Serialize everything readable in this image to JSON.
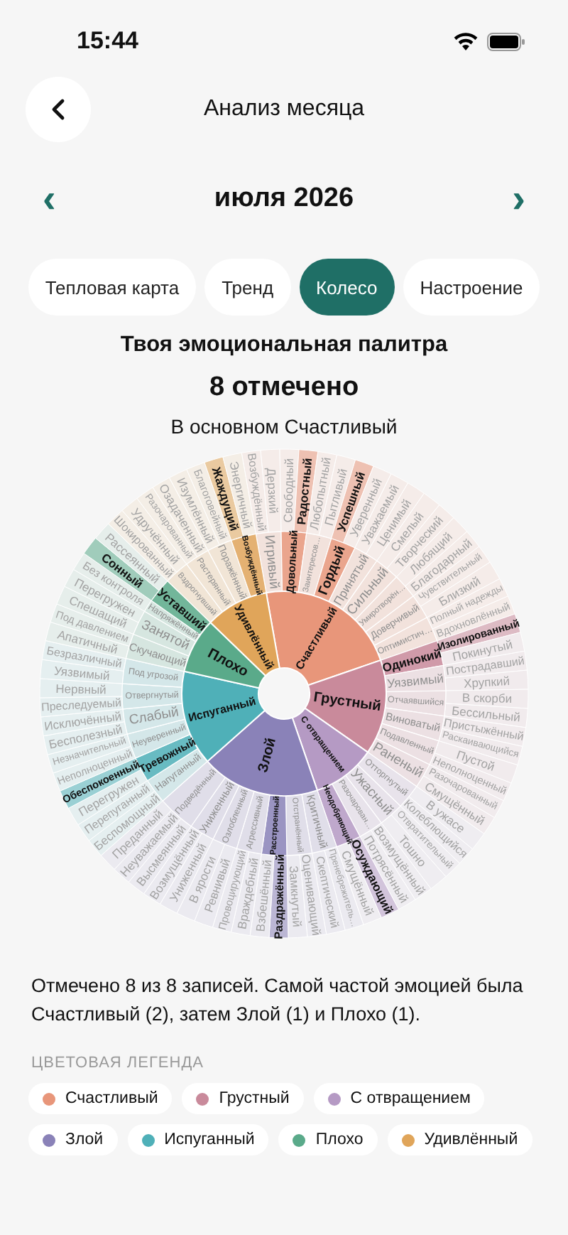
{
  "status_bar": {
    "time": "15:44"
  },
  "header": {
    "title": "Анализ месяца"
  },
  "month_nav": {
    "prev": "‹",
    "label": "июля 2026",
    "next": "›"
  },
  "tabs": [
    {
      "label": "Тепловая карта",
      "selected": false
    },
    {
      "label": "Тренд",
      "selected": false
    },
    {
      "label": "Колесо",
      "selected": true
    },
    {
      "label": "Настроение",
      "selected": false
    }
  ],
  "summary": {
    "title": "Твоя эмоциональная палитра",
    "count": "8 отмечено",
    "subtitle": "В основном Счастливый"
  },
  "wheel": {
    "core": [
      {
        "label": "Счастливый",
        "color": "#e8967a",
        "marked": true,
        "children": [
          {
            "label": "Игривый",
            "marked": false,
            "children": [
              {
                "label": "Возбуждённый",
                "marked": false
              },
              {
                "label": "Дерзкий",
                "marked": false
              }
            ]
          },
          {
            "label": "Довольный",
            "marked": true,
            "children": [
              {
                "label": "Свободный",
                "marked": false
              },
              {
                "label": "Радостный",
                "marked": true
              }
            ]
          },
          {
            "label": "Заинтересов…",
            "marked": false,
            "children": [
              {
                "label": "Любопытный",
                "marked": false
              },
              {
                "label": "Пытливый",
                "marked": false
              }
            ]
          },
          {
            "label": "Гордый",
            "marked": true,
            "children": [
              {
                "label": "Успешный",
                "marked": true
              },
              {
                "label": "Уверенный",
                "marked": false
              }
            ]
          },
          {
            "label": "Принятый",
            "marked": false,
            "children": [
              {
                "label": "Уважаемый",
                "marked": false
              },
              {
                "label": "Ценимый",
                "marked": false
              }
            ]
          },
          {
            "label": "Сильный",
            "marked": false,
            "children": [
              {
                "label": "Смелый",
                "marked": false
              },
              {
                "label": "Творческий",
                "marked": false
              }
            ]
          },
          {
            "label": "Умиротворён…",
            "marked": false,
            "children": [
              {
                "label": "Любящий",
                "marked": false
              },
              {
                "label": "Благодарный",
                "marked": false
              }
            ]
          },
          {
            "label": "Доверчивый",
            "marked": false,
            "children": [
              {
                "label": "Чувствительный",
                "marked": false
              },
              {
                "label": "Близкий",
                "marked": false
              }
            ]
          },
          {
            "label": "Оптимистич…",
            "marked": false,
            "children": [
              {
                "label": "Полный надежды",
                "marked": false
              },
              {
                "label": "Вдохновлённый",
                "marked": false
              }
            ]
          }
        ]
      },
      {
        "label": "Грустный",
        "color": "#c98a9b",
        "marked": true,
        "children": [
          {
            "label": "Одинокий",
            "marked": true,
            "children": [
              {
                "label": "Изолированный",
                "marked": true
              },
              {
                "label": "Покинутый",
                "marked": false
              }
            ]
          },
          {
            "label": "Уязвимый",
            "marked": false,
            "children": [
              {
                "label": "Пострадавший",
                "marked": false
              },
              {
                "label": "Хрупкий",
                "marked": false
              }
            ]
          },
          {
            "label": "Отчаявшийся",
            "marked": false,
            "children": [
              {
                "label": "В скорби",
                "marked": false
              },
              {
                "label": "Бессильный",
                "marked": false
              }
            ]
          },
          {
            "label": "Виноватый",
            "marked": false,
            "children": [
              {
                "label": "Пристыжённый",
                "marked": false
              },
              {
                "label": "Раскаивающийся",
                "marked": false
              }
            ]
          },
          {
            "label": "Подавленный",
            "marked": false,
            "children": [
              {
                "label": "Пустой",
                "marked": false
              },
              {
                "label": "Неполноценный",
                "marked": false
              }
            ]
          },
          {
            "label": "Раненый",
            "marked": false,
            "children": [
              {
                "label": "Разочарованный",
                "marked": false
              },
              {
                "label": "Смущённый",
                "marked": false
              }
            ]
          }
        ]
      },
      {
        "label": "С отвращением",
        "color": "#b59ac4",
        "marked": true,
        "children": [
          {
            "label": "Отторгнутый",
            "marked": false,
            "children": [
              {
                "label": "В ужасе",
                "marked": false
              },
              {
                "label": "Колеблющийся",
                "marked": false
              }
            ]
          },
          {
            "label": "Ужасный",
            "marked": false,
            "children": [
              {
                "label": "Отвратительный",
                "marked": false
              },
              {
                "label": "Тошно",
                "marked": false
              }
            ]
          },
          {
            "label": "Разочарован…",
            "marked": false,
            "children": [
              {
                "label": "Возмущённый",
                "marked": false
              },
              {
                "label": "Потрясённый",
                "marked": false
              }
            ]
          },
          {
            "label": "Неодобряющий",
            "marked": true,
            "children": [
              {
                "label": "Осуждающий",
                "marked": true
              },
              {
                "label": "Смущённый",
                "marked": false
              }
            ]
          }
        ]
      },
      {
        "label": "Злой",
        "color": "#8a82b8",
        "marked": true,
        "children": [
          {
            "label": "Критичный",
            "marked": false,
            "children": [
              {
                "label": "Пренебрежитель…",
                "marked": false
              },
              {
                "label": "Скептический",
                "marked": false
              }
            ]
          },
          {
            "label": "Отстранённый",
            "marked": false,
            "children": [
              {
                "label": "Оценивающий",
                "marked": false
              },
              {
                "label": "Замкнутый",
                "marked": false
              }
            ]
          },
          {
            "label": "Расстроенный",
            "marked": true,
            "children": [
              {
                "label": "Раздражённый",
                "marked": true
              },
              {
                "label": "Взбешённый",
                "marked": false
              }
            ]
          },
          {
            "label": "Агрессивный",
            "marked": false,
            "children": [
              {
                "label": "Враждебный",
                "marked": false
              },
              {
                "label": "Провоцирующий",
                "marked": false
              }
            ]
          },
          {
            "label": "Озлобленный",
            "marked": false,
            "children": [
              {
                "label": "Ревнивый",
                "marked": false
              },
              {
                "label": "В ярости",
                "marked": false
              }
            ]
          },
          {
            "label": "Униженный",
            "marked": false,
            "children": [
              {
                "label": "Униженный",
                "marked": false
              },
              {
                "label": "Возмущённый",
                "marked": false
              }
            ]
          },
          {
            "label": "Подведённый",
            "marked": false,
            "children": [
              {
                "label": "Высмеянный",
                "marked": false
              },
              {
                "label": "Неуважаемый",
                "marked": false
              },
              {
                "label": "Преданный",
                "marked": false
              }
            ]
          }
        ]
      },
      {
        "label": "Испуганный",
        "color": "#4fb0b8",
        "marked": true,
        "children": [
          {
            "label": "Напуганный",
            "marked": false,
            "children": [
              {
                "label": "Беспомощный",
                "marked": false
              },
              {
                "label": "Перепуганный",
                "marked": false
              }
            ]
          },
          {
            "label": "Тревожный",
            "marked": true,
            "children": [
              {
                "label": "Перегружен",
                "marked": false
              },
              {
                "label": "Обеспокоенный",
                "marked": true
              }
            ]
          },
          {
            "label": "Неуверенный",
            "marked": false,
            "children": [
              {
                "label": "Неполноценный",
                "marked": false
              },
              {
                "label": "Незначительный",
                "marked": false
              }
            ]
          },
          {
            "label": "Слабый",
            "marked": false,
            "children": [
              {
                "label": "Бесполезный",
                "marked": false
              },
              {
                "label": "Исключённый",
                "marked": false
              }
            ]
          },
          {
            "label": "Отвергнутый",
            "marked": false,
            "children": [
              {
                "label": "Преследуемый",
                "marked": false
              },
              {
                "label": "Нервный",
                "marked": false
              }
            ]
          },
          {
            "label": "Под угрозой",
            "marked": false,
            "children": [
              {
                "label": "Уязвимый",
                "marked": false
              },
              {
                "label": "Безразличный",
                "marked": false
              }
            ]
          }
        ]
      },
      {
        "label": "Плохо",
        "color": "#5aaa8a",
        "marked": true,
        "children": [
          {
            "label": "Скучающий",
            "marked": false,
            "children": [
              {
                "label": "Апатичный",
                "marked": false
              },
              {
                "label": "Под давлением",
                "marked": false
              }
            ]
          },
          {
            "label": "Занятой",
            "marked": false,
            "children": [
              {
                "label": "Спешащий",
                "marked": false
              },
              {
                "label": "Перегружен",
                "marked": false
              }
            ]
          },
          {
            "label": "Напряжённый",
            "marked": false,
            "children": [
              {
                "label": "Без контроля",
                "marked": false
              }
            ]
          },
          {
            "label": "Уставший",
            "marked": true,
            "children": [
              {
                "label": "Сонный",
                "marked": true
              },
              {
                "label": "Рассеянный",
                "marked": false
              }
            ]
          }
        ]
      },
      {
        "label": "Удивлённый",
        "color": "#e0a55a",
        "marked": true,
        "children": [
          {
            "label": "Вздрогнувший",
            "marked": false,
            "children": [
              {
                "label": "Шокированный",
                "marked": false
              },
              {
                "label": "Удручённый",
                "marked": false
              }
            ]
          },
          {
            "label": "Растерянный",
            "marked": false,
            "children": [
              {
                "label": "Разочарованный",
                "marked": false
              },
              {
                "label": "Озадаченный",
                "marked": false
              }
            ]
          },
          {
            "label": "Поражённый",
            "marked": false,
            "children": [
              {
                "label": "Изумлённый",
                "marked": false
              },
              {
                "label": "Благоговейный",
                "marked": false
              }
            ]
          },
          {
            "label": "Возбуждённый",
            "marked": true,
            "children": [
              {
                "label": "Жаждущий",
                "marked": true
              },
              {
                "label": "Энергичный",
                "marked": false
              }
            ]
          }
        ]
      }
    ]
  },
  "description": "Отмечено 8 из 8 записей. Самой частой эмоцией была Счастливый (2), затем Злой (1) и Плохо (1).",
  "legend": {
    "title": "ЦВЕТОВАЯ ЛЕГЕНДА",
    "items": [
      {
        "label": "Счастливый",
        "color": "#e8967a"
      },
      {
        "label": "Грустный",
        "color": "#c98a9b"
      },
      {
        "label": "С отвращением",
        "color": "#b59ac4"
      },
      {
        "label": "Злой",
        "color": "#8a82b8"
      },
      {
        "label": "Испуганный",
        "color": "#4fb0b8"
      },
      {
        "label": "Плохо",
        "color": "#5aaa8a"
      },
      {
        "label": "Удивлённый",
        "color": "#e0a55a"
      }
    ]
  }
}
